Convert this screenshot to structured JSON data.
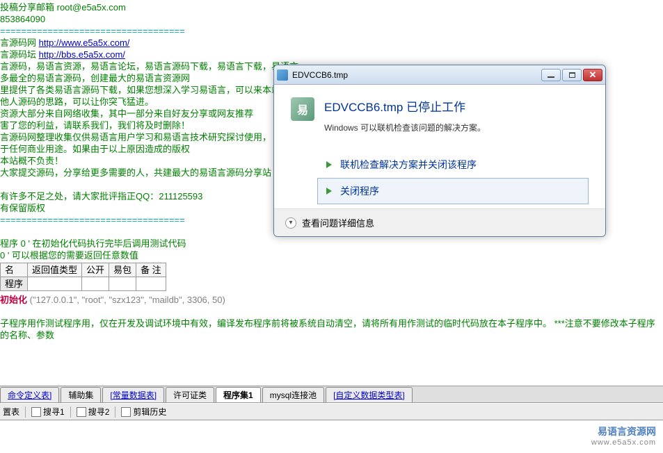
{
  "code": {
    "l1": "投稿分享邮箱  root@e5a5x.com",
    "l2": "        853864090",
    "l3": "===================================",
    "l4a": "言源码网 ",
    "l4b": "http://www.e5a5x.com/",
    "l5a": "言源码坛 ",
    "l5b": "http://bbs.e5a5x.com/",
    "l6": "言源码，易语言资源，易语言论坛，易语言源码下载，易语言下载，易语言",
    "l7": "多最全的易语言源码，创建最大的易语言资源网",
    "l8": "里提供了各类易语言源码下载，如果您想深入学习易语言，可以来本站下载相",
    "l9": "他人源码的思路，可以让你突飞猛进。",
    "l10": "资源大部分来自网络收集，其中一部分来自好友分享或网友推荐",
    "l11": "害了您的利益，请联系我们，我们将及时删除！",
    "l12": "言源码网整理收集仅供易语言用户学习和易语言技术研究探讨使用，",
    "l13": "于任何商业用途。如果由于以上原因造成的版权",
    "l14": "本站概不负责！",
    "l15": "大家提交源码，分享给更多需要的人，共建最大的易语言源码分享站",
    "l16": "有许多不足之处，请大家批评指正QQ：211125593",
    "l17": "有保留版权",
    "l18": "===================================",
    "subProg": "程序  0  '  在初始化代码执行完毕后调用测试代码",
    "ret": " 0  '  可以根据您的需要返回任意数值",
    "tableHeaders": [
      "名",
      "返回值类型",
      "公开",
      "易包",
      "备 注"
    ],
    "tableRow": [
      "程序",
      "",
      "",
      "",
      ""
    ],
    "initLabel": "初始化",
    "initParams": " (\"127.0.0.1\", \"root\", \"szx123\", \"maildb\", 3306, 50)",
    "commentTail": "子程序用作测试程序用，仅在开发及调试环境中有效，编译发布程序前将被系统自动清空，请将所有用作测试的临时代码放在本子程序中。  ***注意不要修改本子程序的名称、参数"
  },
  "dialog": {
    "windowTitle": "EDVCCB6.tmp",
    "mainTitle": "EDVCCB6.tmp 已停止工作",
    "subtitle": "Windows 可以联机检查该问题的解决方案。",
    "option1": "联机检查解决方案并关闭该程序",
    "option2": "关闭程序",
    "details": "查看问题详细信息"
  },
  "tabs": [
    "命令定义表]",
    "辅助集",
    "[常量数据表]",
    "许可证类",
    "程序集1",
    "mysql连接池",
    "[自定义数据类型表]"
  ],
  "toolbar": {
    "t1": "置表",
    "t2": "搜寻1",
    "t3": "搜寻2",
    "t4": "剪辑历史"
  },
  "watermark": {
    "text": "易语言资源网",
    "url": "www.e5a5x.com"
  }
}
